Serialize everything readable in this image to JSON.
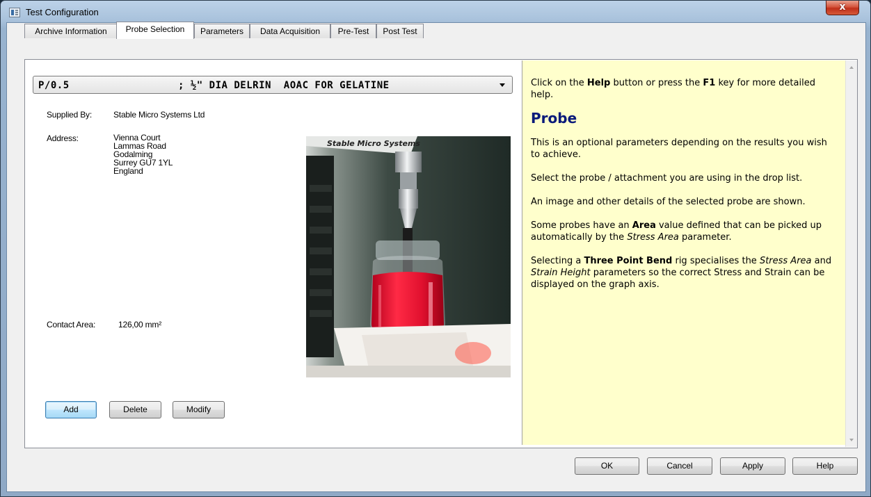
{
  "window": {
    "title": "Test Configuration",
    "close_label": "x"
  },
  "tabs": [
    {
      "label": "Archive Information",
      "active": false
    },
    {
      "label": "Probe Selection",
      "active": true
    },
    {
      "label": "Parameters",
      "active": false
    },
    {
      "label": "Data Acquisition",
      "active": false
    },
    {
      "label": "Pre-Test",
      "active": false
    },
    {
      "label": "Post Test",
      "active": false
    }
  ],
  "probe": {
    "code": "P/0.5",
    "description": "; ½\" DIA DELRIN  AOAC FOR GELATINE",
    "supplied_by_label": "Supplied By:",
    "supplied_by": "Stable Micro Systems Ltd",
    "address_label": "Address:",
    "address_lines": [
      "Vienna Court",
      "Lammas Road",
      "Godalming",
      "Surrey GU7 1YL",
      "England"
    ],
    "contact_area_label": "Contact Area:",
    "contact_area": "126,00 mm²",
    "photo_caption": "Stable Micro Systems"
  },
  "probe_buttons": {
    "add": "Add",
    "delete": "Delete",
    "modify": "Modify"
  },
  "help": {
    "intro_pre": "Click on the ",
    "intro_help": "Help",
    "intro_mid": " button or press the ",
    "intro_key": "F1",
    "intro_post": " key for more detailed help.",
    "heading": "Probe",
    "p1": "This is an optional parameters depending on the results you wish to achieve.",
    "p2": "Select the probe / attachment you are using in the drop list.",
    "p3": "An image and other details of the selected probe are shown.",
    "p4_pre": "Some probes have an ",
    "p4_bold": "Area",
    "p4_mid": " value defined that can be picked up automatically by the ",
    "p4_italic": "Stress Area",
    "p4_post": " parameter.",
    "p5_pre": "Selecting a ",
    "p5_bold": "Three Point Bend",
    "p5_mid": " rig specialises the ",
    "p5_italic1": "Stress Area",
    "p5_and": " and ",
    "p5_italic2": "Strain Height",
    "p5_post": " parameters so the correct Stress and Strain can be displayed on the graph axis."
  },
  "dialog_buttons": {
    "ok": "OK",
    "cancel": "Cancel",
    "apply": "Apply",
    "help": "Help"
  }
}
